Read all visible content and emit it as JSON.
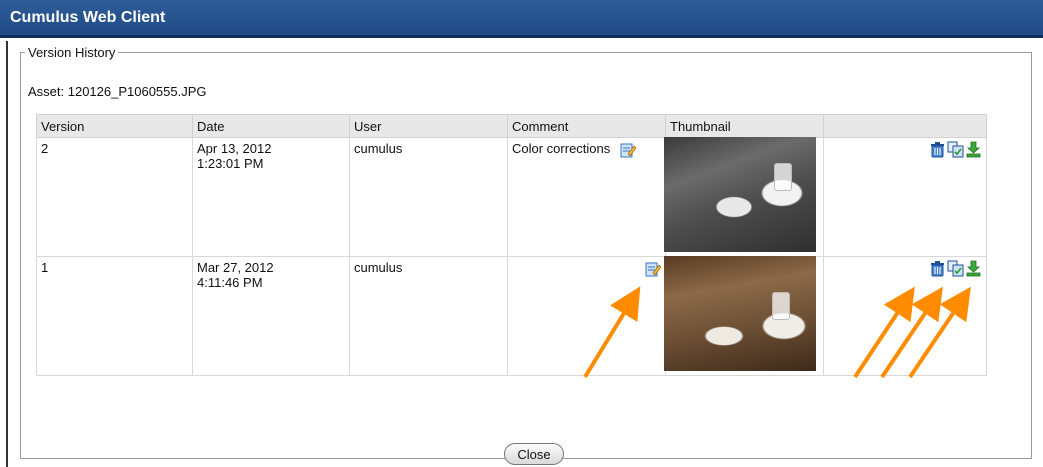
{
  "window": {
    "title": "Cumulus Web Client"
  },
  "version_history": {
    "legend": "Version History",
    "asset_label": "Asset: 120126_P1060555.JPG",
    "columns": [
      "Version",
      "Date",
      "User",
      "Comment",
      "Thumbnail",
      ""
    ],
    "rows": [
      {
        "version": "2",
        "date_line1": "Apr 13, 2012",
        "date_line2": "1:23:01 PM",
        "user": "cumulus",
        "comment": "Color corrections",
        "thumbnail": "grayscale-photo"
      },
      {
        "version": "1",
        "date_line1": "Mar 27, 2012",
        "date_line2": "4:11:46 PM",
        "user": "cumulus",
        "comment": "",
        "thumbnail": "color-photo"
      }
    ],
    "row_actions": [
      "delete-icon",
      "restore-version-icon",
      "download-icon"
    ],
    "close_label": "Close"
  },
  "colors": {
    "titlebar": "#2b5896",
    "annotation_arrow": "#ff8c00",
    "header_bg": "#e8e8e8"
  }
}
